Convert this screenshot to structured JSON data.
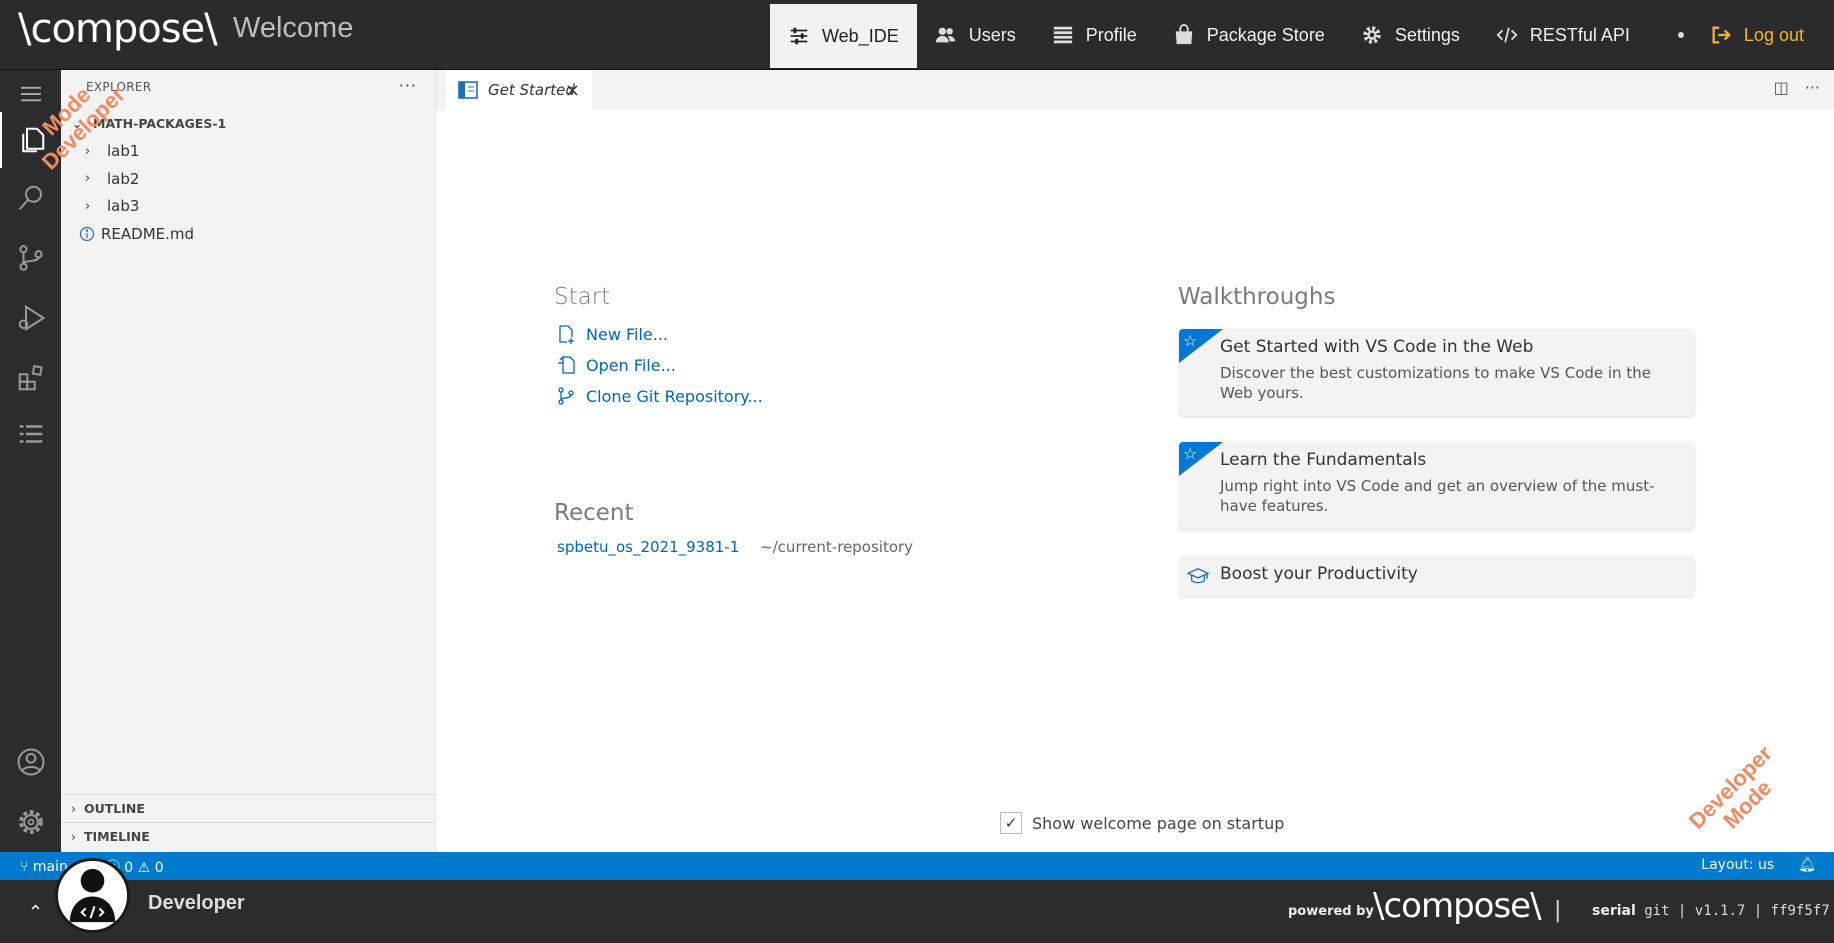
{
  "app": {
    "brand": "\\compose\\",
    "title": "Welcome"
  },
  "nav": {
    "items": [
      {
        "label": "Web_IDE",
        "icon": "sliders-icon"
      },
      {
        "label": "Users",
        "icon": "users-icon"
      },
      {
        "label": "Profile",
        "icon": "list-icon"
      },
      {
        "label": "Package Store",
        "icon": "shopping-bag-icon"
      },
      {
        "label": "Settings",
        "icon": "gear-icon"
      },
      {
        "label": "RESTful API",
        "icon": "code-icon"
      }
    ],
    "logout": "Log out"
  },
  "sidebar": {
    "title": "EXPLORER",
    "more": "···",
    "root": "MATH-PACKAGES-1",
    "items": [
      "lab1",
      "lab2",
      "lab3"
    ],
    "readme": "README.md",
    "outline": "OUTLINE",
    "timeline": "TIMELINE"
  },
  "editor": {
    "tab": "Get Started",
    "start": {
      "heading": "Start",
      "links": [
        "New File...",
        "Open File...",
        "Clone Git Repository..."
      ]
    },
    "recent": {
      "heading": "Recent",
      "name": "spbetu_os_2021_9381-1",
      "path": "~/current-repository"
    },
    "walkthroughs": {
      "heading": "Walkthroughs",
      "cards": [
        {
          "title": "Get Started with VS Code in the Web",
          "desc": "Discover the best customizations to make VS Code in the Web yours."
        },
        {
          "title": "Learn the Fundamentals",
          "desc": "Jump right into VS Code and get an overview of the must-have features."
        },
        {
          "title": "Boost your Productivity",
          "desc": ""
        }
      ]
    },
    "startup_label": "Show welcome page on startup"
  },
  "watermark": {
    "line1": "Developer",
    "line2": "Mode"
  },
  "status": {
    "branch": "main",
    "errors": "0",
    "warnings": "0",
    "layout": "Layout: us"
  },
  "footer": {
    "user": "Developer",
    "powered": "powered by",
    "logo": "\\compose\\",
    "version_label": "serial",
    "version": "git | v1.1.7 | ff9f5f7"
  },
  "colors": {
    "accent": "#007acc",
    "link": "#0066b8",
    "logout": "#f5b233",
    "watermark": "#ef8a61"
  }
}
